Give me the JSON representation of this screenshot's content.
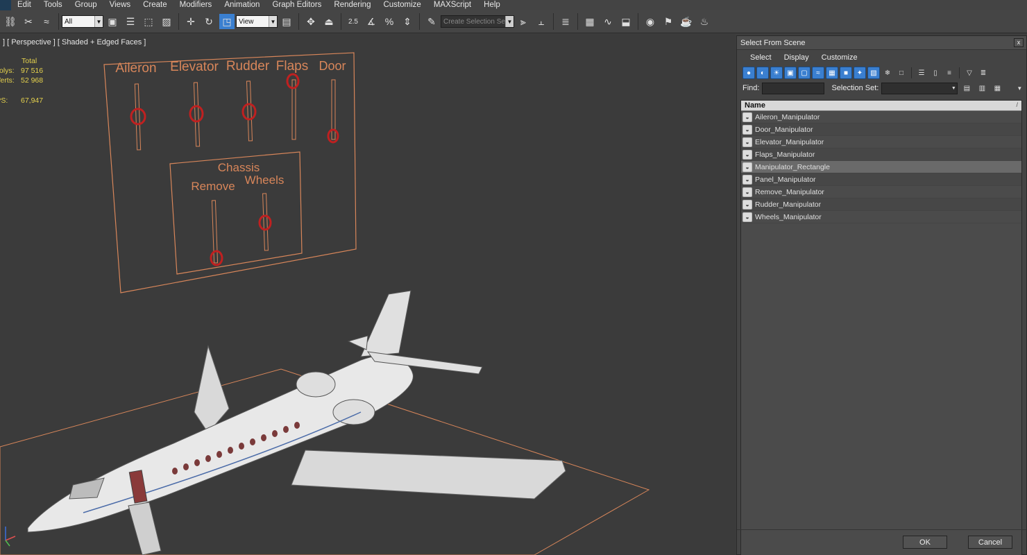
{
  "menubar": {
    "items": [
      "Edit",
      "Tools",
      "Group",
      "Views",
      "Create",
      "Modifiers",
      "Animation",
      "Graph Editors",
      "Rendering",
      "Customize",
      "MAXScript",
      "Help"
    ]
  },
  "toolbar": {
    "filter_value": "All",
    "ref_coord_value": "View",
    "selection_set_placeholder": "Create Selection Se",
    "snap_label": "2.5"
  },
  "viewport": {
    "label": "] [ Perspective ] [ Shaded + Edged Faces ]",
    "stats": {
      "header": "Total",
      "polys_label": "Polys:",
      "polys_value": "97 516",
      "verts_label": "Verts:",
      "verts_value": "52 968",
      "fps_label": "FPS:",
      "fps_value": "67,947"
    },
    "panel": {
      "sliders": [
        "Aileron",
        "Elevator",
        "Rudder",
        "Flaps",
        "Door"
      ],
      "chassis_title": "Chassis",
      "chassis_sliders": [
        "Remove",
        "Wheels"
      ]
    }
  },
  "dialog": {
    "title": "Select From Scene",
    "close": "x",
    "menu": [
      "Select",
      "Display",
      "Customize"
    ],
    "find_label": "Find:",
    "find_value": "",
    "selection_set_label": "Selection Set:",
    "column_header": "Name",
    "sort_glyph": "/",
    "items": [
      {
        "name": "Aileron_Manipulator",
        "selected": false
      },
      {
        "name": "Door_Manipulator",
        "selected": false
      },
      {
        "name": "Elevator_Manipulator",
        "selected": false
      },
      {
        "name": "Flaps_Manipulator",
        "selected": false
      },
      {
        "name": "Manipulator_Rectangle",
        "selected": true
      },
      {
        "name": "Panel_Manipulator",
        "selected": false
      },
      {
        "name": "Remove_Manipulator",
        "selected": false
      },
      {
        "name": "Rudder_Manipulator",
        "selected": false
      },
      {
        "name": "Wheels_Manipulator",
        "selected": false
      }
    ],
    "ok_label": "OK",
    "cancel_label": "Cancel"
  },
  "colors": {
    "panel_orange": "#d8865a",
    "handle_red": "#c02020",
    "stats_yellow": "#e6d24d"
  }
}
